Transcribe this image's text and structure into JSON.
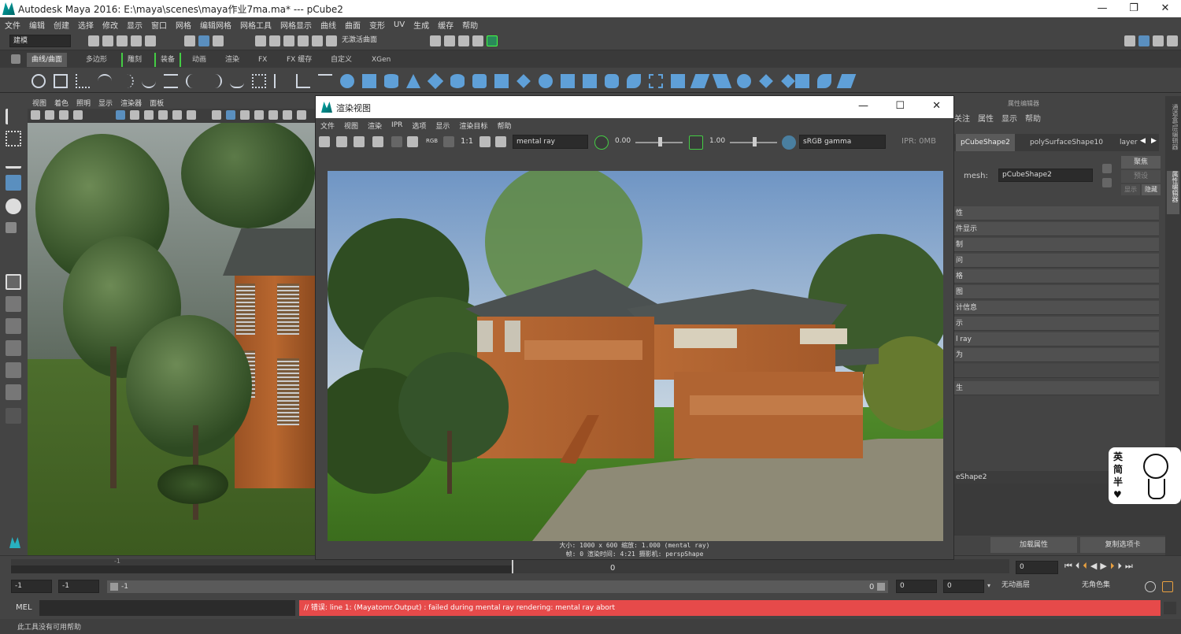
{
  "app": {
    "title": "Autodesk Maya 2016: E:\\maya\\scenes\\maya作业7ma.ma*   ---   pCube2"
  },
  "window_controls": {
    "minimize": "—",
    "maximize": "❐",
    "close": "✕"
  },
  "main_menu": [
    "文件",
    "编辑",
    "创建",
    "选择",
    "修改",
    "显示",
    "窗口",
    "网格",
    "编辑网格",
    "网格工具",
    "网格显示",
    "曲线",
    "曲面",
    "变形",
    "UV",
    "生成",
    "缓存",
    "帮助"
  ],
  "status_line": {
    "mode": "建模",
    "surface": "无激活曲面"
  },
  "shelf_tabs": [
    "曲线/曲面",
    "多边形",
    "雕刻",
    "装备",
    "动画",
    "渲染",
    "FX",
    "FX 缓存",
    "自定义",
    "XGen"
  ],
  "viewport": {
    "menu": [
      "视图",
      "着色",
      "照明",
      "显示",
      "渲染器",
      "面板"
    ]
  },
  "render_view": {
    "title": "渲染视图",
    "menu": [
      "文件",
      "视图",
      "渲染",
      "IPR",
      "选项",
      "显示",
      "渲染目标",
      "帮助"
    ],
    "ratio": "1:1",
    "renderer": "mental ray",
    "exposure": "0.00",
    "gamma": "1.00",
    "color_space": "sRGB gamma",
    "ipr_mem": "IPR: 0MB",
    "rgb": "RGB",
    "info_line1": "大小: 1000 x 600  缩放: 1.000         (mental ray)",
    "info_line2": "帧: 0        渲染时间:  4:21        摄影机: perspShape"
  },
  "attr_editor": {
    "header": "属性编辑器",
    "menu": [
      "关注",
      "属性",
      "显示",
      "帮助"
    ],
    "tabs": [
      "pCubeShape2",
      "polySurfaceShape10",
      "layer"
    ],
    "mesh_label": "mesh:",
    "mesh_value": "pCubeShape2",
    "buttons": {
      "focus": "聚焦",
      "preset": "预设",
      "show": "显示",
      "hide": "隐藏"
    },
    "sections": [
      "性",
      "件显示",
      "制",
      "问",
      "格",
      "图",
      "计信息",
      "示",
      "l ray",
      "为",
      "生"
    ],
    "shape_label": "eShape2",
    "load_attr": "加载属性",
    "copy_tab": "复制选项卡"
  },
  "side_tabs": [
    "通道盒/层编辑器",
    "属性编辑器"
  ],
  "time": {
    "marker_left": "-1",
    "marker_mid": "0",
    "current": "0"
  },
  "range": {
    "start": "-1",
    "start2": "-1",
    "bar_label": "-1",
    "bar_end": "0",
    "end": "0",
    "end2": "0",
    "anim_layer": "无动画层",
    "char_set": "无角色集"
  },
  "command": {
    "lang": "MEL",
    "error": "// 错误: line 1: (Mayatomr.Output) : failed during mental ray rendering: mental ray abort"
  },
  "help_line": "此工具没有可用帮助",
  "sticker": {
    "chars": [
      "英",
      "简",
      "半"
    ],
    "heart": "♥"
  }
}
